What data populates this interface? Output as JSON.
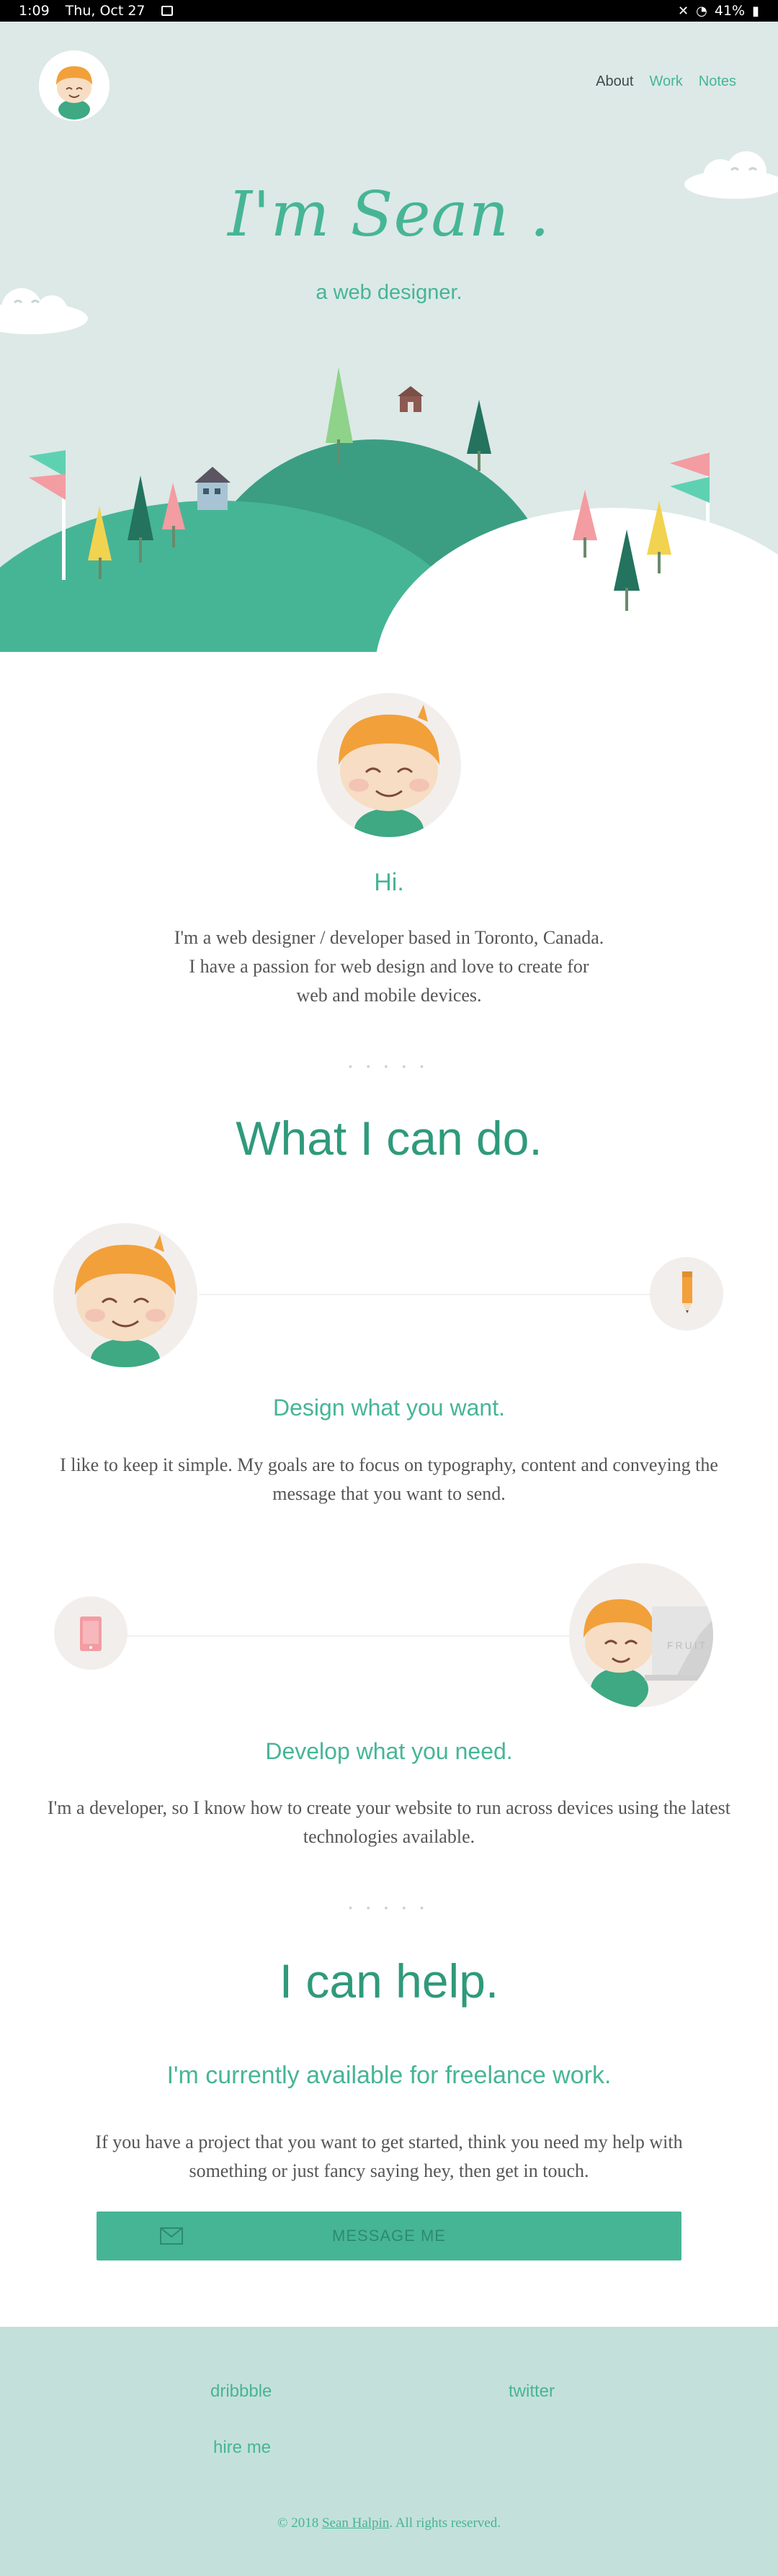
{
  "status_bar": {
    "time": "1:09",
    "date": "Thu, Oct 27",
    "battery": "41%"
  },
  "nav": {
    "about": "About",
    "work": "Work",
    "notes": "Notes"
  },
  "hero": {
    "title": "I'm Sean .",
    "subtitle": "a web designer."
  },
  "intro": {
    "heading": "Hi.",
    "text": "I'm a web designer / developer based in Toronto, Canada. I have a passion for web design and love to create for web and mobile devices.",
    "divider": "• • • • •"
  },
  "skills": {
    "title": "What I can do.",
    "design": {
      "heading": "Design what you want.",
      "text": "I like to keep it simple. My goals are to focus on typography, content and conveying the message that you want to send."
    },
    "develop": {
      "heading": "Develop what you need.",
      "text": "I'm a developer, so I know how to create your website to run across devices using the latest technologies available.",
      "monitor_label": "FRUIT"
    },
    "divider": "• • • • •"
  },
  "help": {
    "title": "I can help.",
    "subtitle": "I'm currently available for freelance work.",
    "text": "If you have a project that you want to get started, think you need my help with something or just fancy saying hey, then get in touch.",
    "button_label": "MESSAGE ME"
  },
  "footer": {
    "links": {
      "dribbble": "dribbble",
      "twitter": "twitter",
      "hire": "hire me"
    },
    "copyright_prefix": "© 2018",
    "copyright_name": "Sean Halpin",
    "copyright_suffix": ". All rights reserved."
  },
  "colors": {
    "accent": "#46b596",
    "accent_dark": "#2f9a7b",
    "hero_bg": "#dce9e7",
    "footer_bg": "#c4e0da"
  }
}
